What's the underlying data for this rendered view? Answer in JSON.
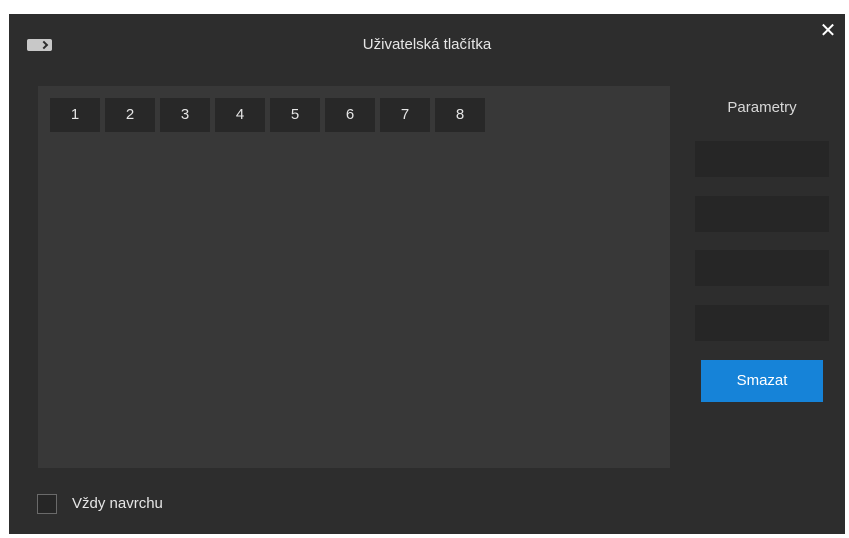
{
  "window": {
    "title": "Uživatelská tlačítka",
    "close_glyph": "✕",
    "icon": "app-toggle-icon"
  },
  "tabs": [
    "1",
    "2",
    "3",
    "4",
    "5",
    "6",
    "7",
    "8"
  ],
  "params": {
    "label": "Parametry",
    "fields": [
      {
        "value": "",
        "placeholder": ""
      },
      {
        "value": "",
        "placeholder": ""
      },
      {
        "value": "",
        "placeholder": ""
      },
      {
        "value": "",
        "placeholder": ""
      }
    ],
    "clear_label": "Smazat"
  },
  "always_on_top": {
    "label": "Vždy navrchu",
    "checked": false
  },
  "colors": {
    "window_bg": "#2d2d2d",
    "panel_bg": "#383838",
    "tab_bg": "#282828",
    "field_bg": "#262626",
    "accent": "#1683d8",
    "text": "#e6e6e6"
  }
}
